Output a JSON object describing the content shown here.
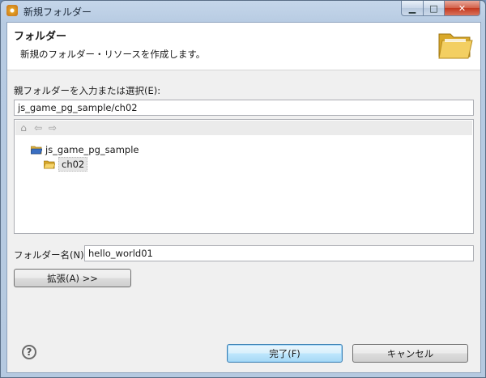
{
  "window": {
    "title": "新規フォルダー",
    "minimize_icon": "minimize-icon",
    "maximize_icon": "maximize-icon",
    "close_icon": "close-icon"
  },
  "banner": {
    "title": "フォルダー",
    "description": "新規のフォルダー・リソースを作成します。",
    "icon": "folder-open-icon"
  },
  "parent": {
    "label": "親フォルダーを入力または選択(E):",
    "value": "js_game_pg_sample/ch02"
  },
  "tree": {
    "toolbar_icons": [
      "home-icon",
      "back-arrow-icon",
      "forward-arrow-icon"
    ],
    "items": [
      {
        "label": "js_game_pg_sample",
        "icon": "project-folder-icon",
        "level": 0,
        "selected": false
      },
      {
        "label": "ch02",
        "icon": "folder-open-icon",
        "level": 1,
        "selected": true
      }
    ]
  },
  "folder_name": {
    "label": "フォルダー名(N):",
    "value": "hello_world01"
  },
  "advanced_button": "拡張(A) >>",
  "footer": {
    "help_icon": "help-icon",
    "finish_label": "完了(F)",
    "cancel_label": "キャンセル"
  }
}
